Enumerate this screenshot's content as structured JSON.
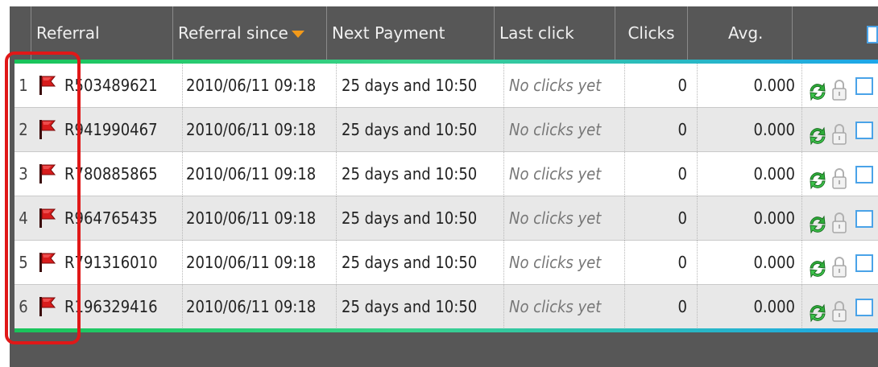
{
  "header": {
    "referral": "Referral",
    "referral_since": "Referral since",
    "next_payment": "Next Payment",
    "last_click": "Last click",
    "clicks": "Clicks",
    "avg": "Avg."
  },
  "rows": [
    {
      "num": "1",
      "id": "R503489621",
      "since": "2010/06/11 09:18",
      "next": "25 days and 10:50",
      "last": "No clicks yet",
      "clicks": "0",
      "avg": "0.000"
    },
    {
      "num": "2",
      "id": "R941990467",
      "since": "2010/06/11 09:18",
      "next": "25 days and 10:50",
      "last": "No clicks yet",
      "clicks": "0",
      "avg": "0.000"
    },
    {
      "num": "3",
      "id": "R780885865",
      "since": "2010/06/11 09:18",
      "next": "25 days and 10:50",
      "last": "No clicks yet",
      "clicks": "0",
      "avg": "0.000"
    },
    {
      "num": "4",
      "id": "R964765435",
      "since": "2010/06/11 09:18",
      "next": "25 days and 10:50",
      "last": "No clicks yet",
      "clicks": "0",
      "avg": "0.000"
    },
    {
      "num": "5",
      "id": "R791316010",
      "since": "2010/06/11 09:18",
      "next": "25 days and 10:50",
      "last": "No clicks yet",
      "clicks": "0",
      "avg": "0.000"
    },
    {
      "num": "6",
      "id": "R196329416",
      "since": "2010/06/11 09:18",
      "next": "25 days and 10:50",
      "last": "No clicks yet",
      "clicks": "0",
      "avg": "0.000"
    }
  ],
  "colors": {
    "header_bg": "#575757",
    "flag_red": "#d81c1c",
    "recycle_green": "#2fae3a",
    "band_green": "#19c45a",
    "band_blue": "#1da6ea",
    "highlight_red": "#e01818",
    "checkbox_blue": "#4aa3e8"
  },
  "icons": [
    "flag-icon",
    "recycle-icon",
    "lock-icon",
    "sort-desc-arrow-icon"
  ]
}
